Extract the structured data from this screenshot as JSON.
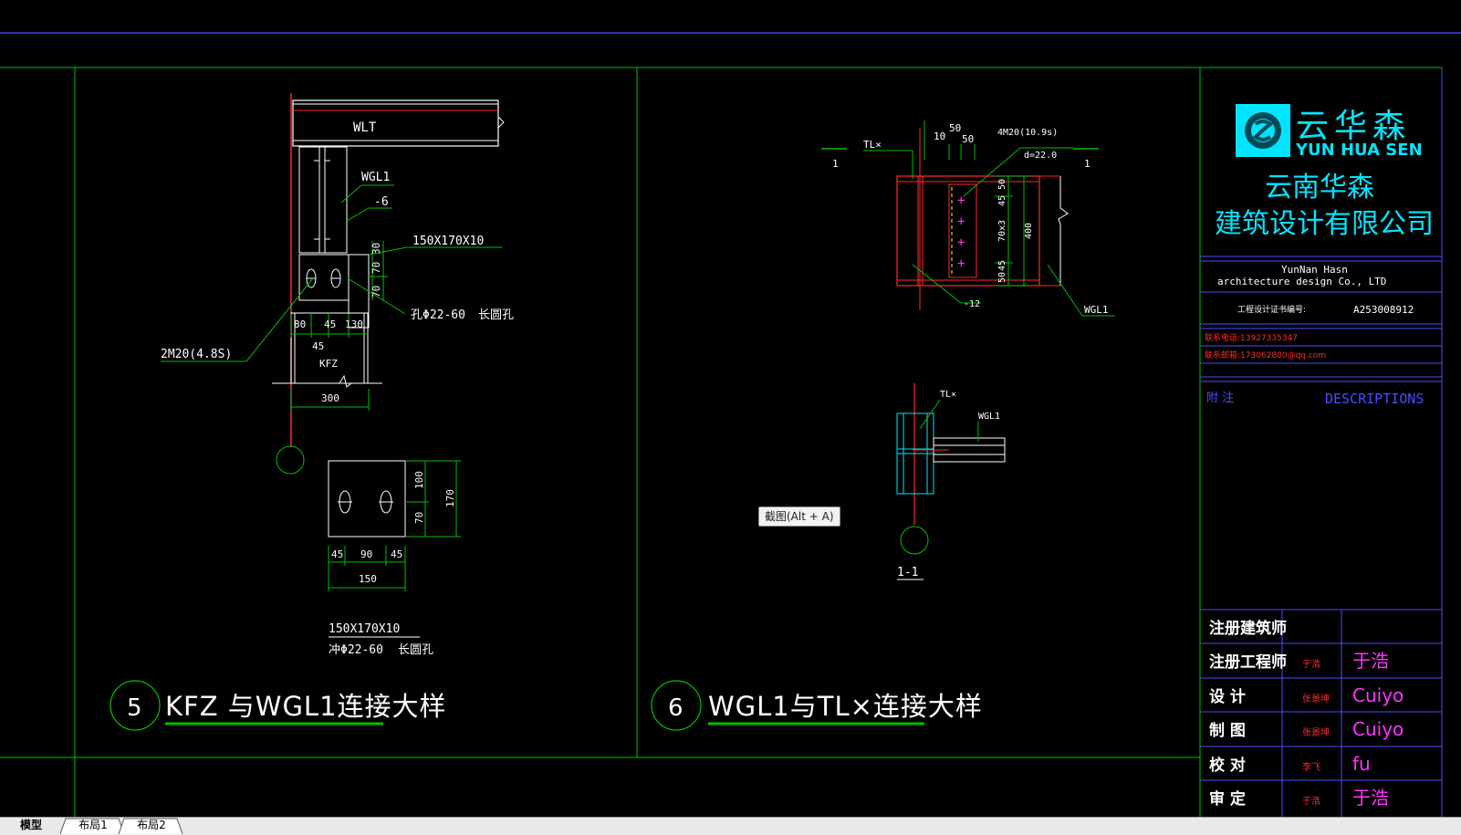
{
  "colors": {
    "background": "#000000",
    "frame": "#4b4bff",
    "border": "#00c000",
    "steel": "#ffffff",
    "red": "#ff2a2a",
    "cyan": "#00e5ff",
    "magenta": "#ff33ff",
    "yellow": "#ffff00"
  },
  "detail5": {
    "number": "5",
    "title": "KFZ 与WGL1连接大样",
    "labels": {
      "wlt": "WLT",
      "wgl1": "WGL1",
      "minus6": "-6",
      "plate": "150X170X10",
      "hole": "孔Φ22-60",
      "slot": "长圆孔",
      "bolts": "2M20(4.8S)",
      "kfz": "KFZ",
      "d30": "30",
      "d70a": "70",
      "d70b": "70",
      "d80": "80",
      "d45": "45",
      "d130": "130",
      "d45b": "45",
      "d300": "300",
      "pd100": "100",
      "pd70": "70",
      "pd170": "170",
      "pd45a": "45",
      "pd90": "90",
      "pd45b": "45",
      "pd150": "150",
      "note1": "150X170X10",
      "note2": "冲Φ22-60",
      "note3": "长圆孔"
    }
  },
  "detail6": {
    "number": "6",
    "title": "WGL1与TL×连接大样",
    "labels": {
      "tlx": "TL×",
      "sec1a": "1",
      "sec1b": "1",
      "d10": "10",
      "d50a": "50",
      "d50b": "50",
      "bolts": "4M20(10.9s)",
      "dia": "d=22.0",
      "d45": "45",
      "d50c": "50",
      "d70x3": "70x3",
      "d400": "400",
      "d50d": "50",
      "d45b": "45",
      "minus12": "-12",
      "wgl1": "WGL1",
      "tlx2": "TL×",
      "wgl1b": "WGL1",
      "section": "1-1"
    }
  },
  "titleblock": {
    "logo_cn": "云华森",
    "logo_en": "YUN HUA SEN",
    "company_line1": "云南华森",
    "company_line2": "建筑设计有限公司",
    "company_en_line1": "YunNan   Hasn",
    "company_en_line2": "architecture    design   Co.,   LTD",
    "cert_label": "工程设计证书编号:",
    "cert_no": "A253008912",
    "phone": "联系电话:13927335347",
    "email": "联系邮箱:173062800@qq.com",
    "notes_label": "附   注",
    "descriptions": "DESCRIPTIONS",
    "rows": [
      {
        "label": "注册建筑师",
        "name": "",
        "sign": ""
      },
      {
        "label": "注册工程师",
        "name": "于浩",
        "sign": "于浩"
      },
      {
        "label": "设  计",
        "name": "张景坤",
        "sign": "Cuiyo"
      },
      {
        "label": "制  图",
        "name": "张景坤",
        "sign": "Cuiyo"
      },
      {
        "label": "校  对",
        "name": "李飞",
        "sign": "fu"
      },
      {
        "label": "审  定",
        "name": "于浩",
        "sign": "于浩"
      }
    ]
  },
  "tooltip": "截图(Alt + A)",
  "tabs": [
    "模型",
    "布局1",
    "布局2"
  ]
}
